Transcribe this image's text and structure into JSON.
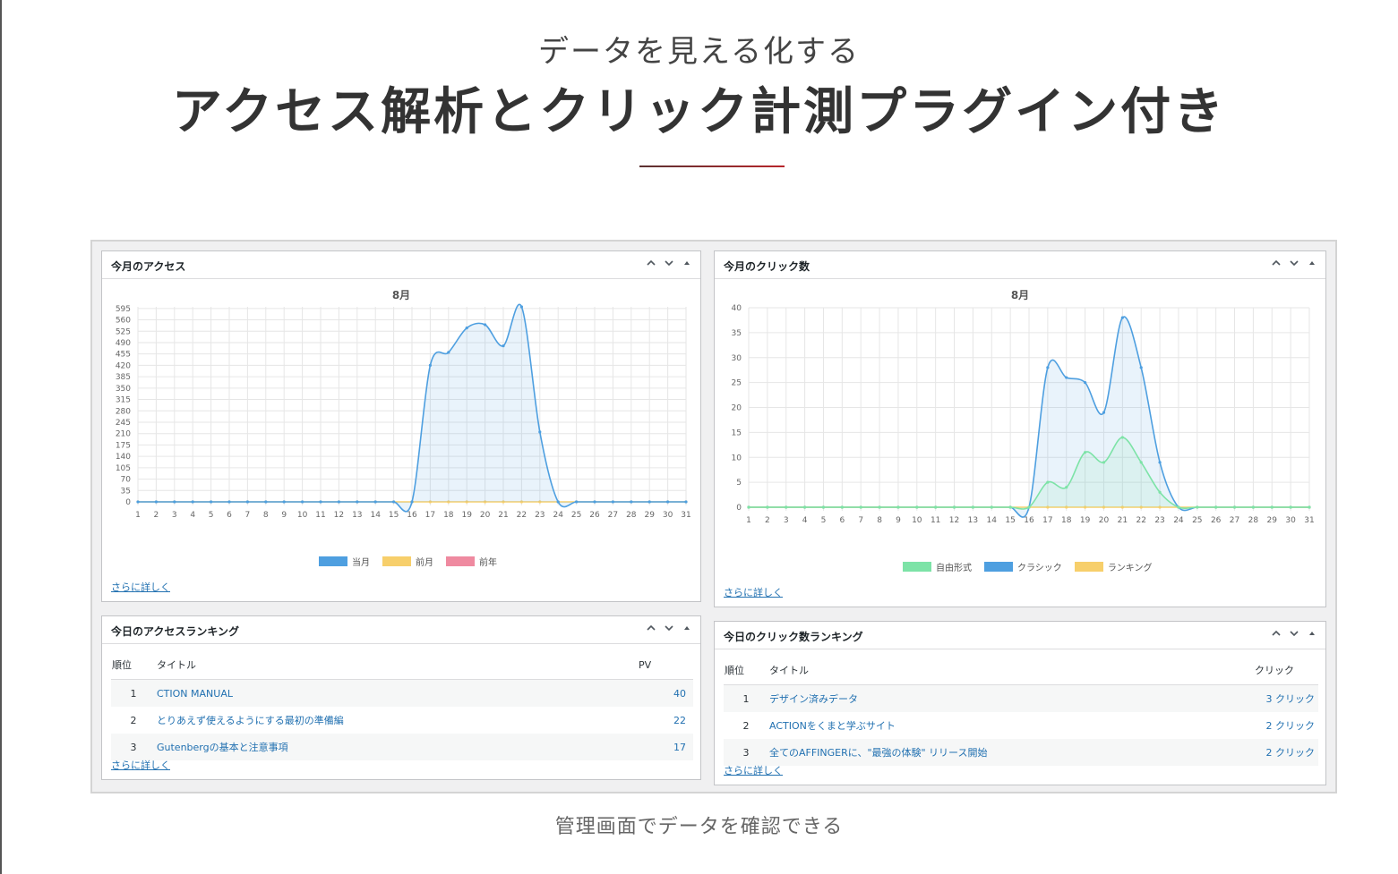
{
  "hero": {
    "subtitle": "データを見える化する",
    "title": "アクセス解析とクリック計測プラグイン付き"
  },
  "caption": "管理画面でデータを確認できる",
  "access_widget": {
    "title": "今月のアクセス",
    "chart_title": "8月",
    "more_link": "さらに詳しく",
    "legend": [
      {
        "label": "当月",
        "color": "#4e9fe0"
      },
      {
        "label": "前月",
        "color": "#f7cf6b"
      },
      {
        "label": "前年",
        "color": "#ef8aa0"
      }
    ]
  },
  "click_widget": {
    "title": "今月のクリック数",
    "chart_title": "8月",
    "more_link": "さらに詳しく",
    "legend": [
      {
        "label": "自由形式",
        "color": "#7de3a7"
      },
      {
        "label": "クラシック",
        "color": "#4e9fe0"
      },
      {
        "label": "ランキング",
        "color": "#f7cf6b"
      }
    ]
  },
  "access_ranking": {
    "title": "今日のアクセスランキング",
    "headers": {
      "rank": "順位",
      "title": "タイトル",
      "value": "PV"
    },
    "rows": [
      {
        "rank": "1",
        "title": "CTION MANUAL",
        "value": "40"
      },
      {
        "rank": "2",
        "title": "とりあえず使えるようにする最初の準備編",
        "value": "22"
      },
      {
        "rank": "3",
        "title": "Gutenbergの基本と注意事項",
        "value": "17"
      }
    ],
    "more_link": "さらに詳しく"
  },
  "click_ranking": {
    "title": "今日のクリック数ランキング",
    "headers": {
      "rank": "順位",
      "title": "タイトル",
      "value": "クリック"
    },
    "rows": [
      {
        "rank": "1",
        "title": "デザイン済みデータ",
        "value": "3 クリック"
      },
      {
        "rank": "2",
        "title": "ACTIONをくまと学ぶサイト",
        "value": "2 クリック"
      },
      {
        "rank": "3",
        "title": "全てのAFFINGERに、\"最強の体験\" リリース開始",
        "value": "2 クリック"
      }
    ],
    "more_link": "さらに詳しく"
  },
  "chart_data": [
    {
      "type": "area",
      "title": "8月",
      "x": [
        1,
        2,
        3,
        4,
        5,
        6,
        7,
        8,
        9,
        10,
        11,
        12,
        13,
        14,
        15,
        16,
        17,
        18,
        19,
        20,
        21,
        22,
        23,
        24,
        25,
        26,
        27,
        28,
        29,
        30,
        31
      ],
      "ylim": [
        0,
        600
      ],
      "yticks": [
        0,
        35,
        70,
        105,
        140,
        175,
        210,
        245,
        280,
        315,
        350,
        385,
        420,
        455,
        490,
        525,
        560,
        595
      ],
      "grid": true,
      "legend_position": "bottom",
      "series": [
        {
          "name": "当月",
          "color": "#4e9fe0",
          "values": [
            0,
            0,
            0,
            0,
            0,
            0,
            0,
            0,
            0,
            0,
            0,
            0,
            0,
            0,
            0,
            0,
            420,
            460,
            535,
            545,
            480,
            600,
            215,
            0,
            0,
            0,
            0,
            0,
            0,
            0,
            0
          ]
        },
        {
          "name": "前月",
          "color": "#f7cf6b",
          "values": [
            0,
            0,
            0,
            0,
            0,
            0,
            0,
            0,
            0,
            0,
            0,
            0,
            0,
            0,
            0,
            0,
            0,
            0,
            0,
            0,
            0,
            0,
            0,
            0,
            0,
            0,
            0,
            0,
            0,
            0,
            0
          ]
        },
        {
          "name": "前年",
          "color": "#ef8aa0",
          "values": []
        }
      ]
    },
    {
      "type": "area",
      "title": "8月",
      "x": [
        1,
        2,
        3,
        4,
        5,
        6,
        7,
        8,
        9,
        10,
        11,
        12,
        13,
        14,
        15,
        16,
        17,
        18,
        19,
        20,
        21,
        22,
        23,
        24,
        25,
        26,
        27,
        28,
        29,
        30,
        31
      ],
      "ylim": [
        0,
        40
      ],
      "yticks": [
        0,
        5,
        10,
        15,
        20,
        25,
        30,
        35,
        40
      ],
      "grid": true,
      "legend_position": "bottom",
      "series": [
        {
          "name": "自由形式",
          "color": "#7de3a7",
          "values": [
            0,
            0,
            0,
            0,
            0,
            0,
            0,
            0,
            0,
            0,
            0,
            0,
            0,
            0,
            0,
            0,
            5,
            4,
            11,
            9,
            14,
            9,
            3,
            0,
            0,
            0,
            0,
            0,
            0,
            0,
            0
          ]
        },
        {
          "name": "クラシック",
          "color": "#4e9fe0",
          "values": [
            0,
            0,
            0,
            0,
            0,
            0,
            0,
            0,
            0,
            0,
            0,
            0,
            0,
            0,
            0,
            0,
            28,
            26,
            25,
            19,
            38,
            28,
            9,
            0,
            0,
            0,
            0,
            0,
            0,
            0,
            0
          ]
        },
        {
          "name": "ランキング",
          "color": "#f7cf6b",
          "values": [
            0,
            0,
            0,
            0,
            0,
            0,
            0,
            0,
            0,
            0,
            0,
            0,
            0,
            0,
            0,
            0,
            0,
            0,
            0,
            0,
            0,
            0,
            0,
            0,
            0,
            0,
            0,
            0,
            0,
            0,
            0
          ]
        }
      ]
    }
  ]
}
